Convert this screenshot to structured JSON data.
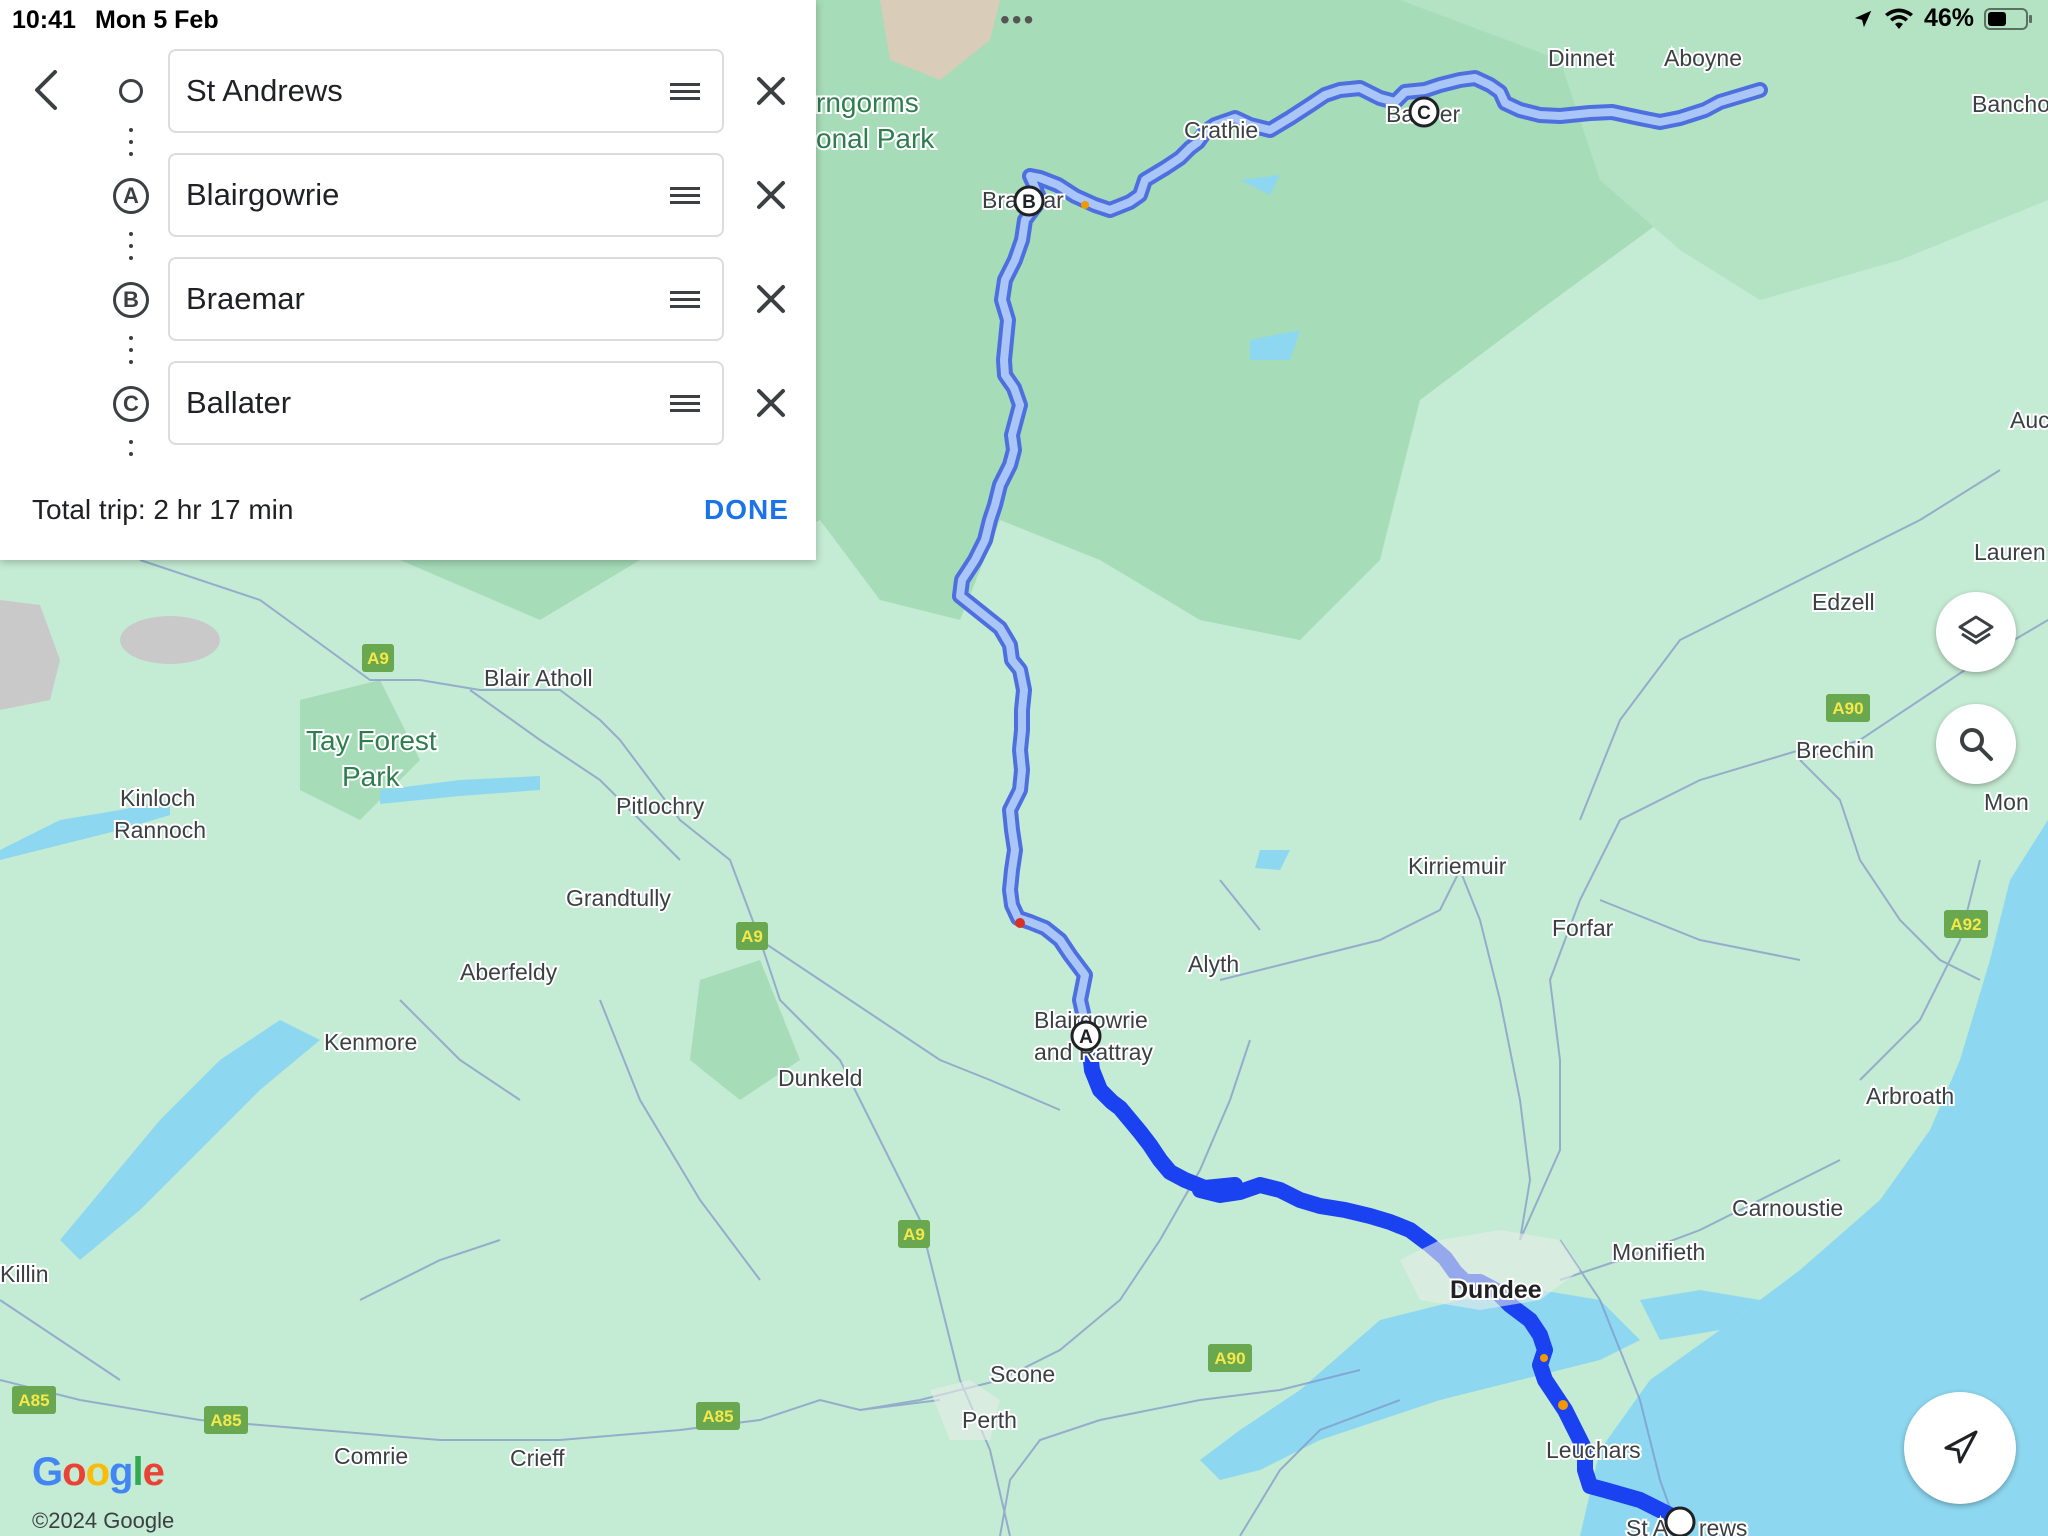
{
  "status_bar": {
    "time": "10:41",
    "date": "Mon 5 Feb",
    "battery": "46%"
  },
  "directions_panel": {
    "stops": [
      {
        "marker": "",
        "name": "St Andrews"
      },
      {
        "marker": "A",
        "name": "Blairgowrie"
      },
      {
        "marker": "B",
        "name": "Braemar"
      },
      {
        "marker": "C",
        "name": "Ballater"
      }
    ],
    "total_trip": "Total trip: 2 hr 17 min",
    "done_label": "DONE"
  },
  "map": {
    "places": [
      {
        "id": "dinnet",
        "name": "Dinnet"
      },
      {
        "id": "aboyne",
        "name": "Aboyne"
      },
      {
        "id": "banchory",
        "name": "Bancho"
      },
      {
        "id": "cairngorms1",
        "name": "rngorms"
      },
      {
        "id": "cairngorms2",
        "name": "onal Park"
      },
      {
        "id": "crathie",
        "name": "Crathie"
      },
      {
        "id": "ballater",
        "name": "Ba    er"
      },
      {
        "id": "braemar",
        "name": "Bra    ar"
      },
      {
        "id": "auchen",
        "name": "Auc"
      },
      {
        "id": "laurence",
        "name": "Lauren"
      },
      {
        "id": "edzell",
        "name": "Edzell"
      },
      {
        "id": "blair-atholl",
        "name": "Blair Atholl"
      },
      {
        "id": "tay-forest1",
        "name": "Tay Forest"
      },
      {
        "id": "tay-forest2",
        "name": "Park"
      },
      {
        "id": "kinloch1",
        "name": "Kinloch"
      },
      {
        "id": "kinloch2",
        "name": "Rannoch"
      },
      {
        "id": "pitlochry",
        "name": "Pitlochry"
      },
      {
        "id": "brechin",
        "name": "Brechin"
      },
      {
        "id": "montrose",
        "name": "Mon"
      },
      {
        "id": "kirriemuir",
        "name": "Kirriemuir"
      },
      {
        "id": "grandtully",
        "name": "Grandtully"
      },
      {
        "id": "forfar",
        "name": "Forfar"
      },
      {
        "id": "alyth",
        "name": "Alyth"
      },
      {
        "id": "aberfeldy",
        "name": "Aberfeldy"
      },
      {
        "id": "blairgowrie1",
        "name": "Blairgowrie"
      },
      {
        "id": "blairgowrie2",
        "name": "and Rattray"
      },
      {
        "id": "kenmore",
        "name": "Kenmore"
      },
      {
        "id": "dunkeld",
        "name": "Dunkeld"
      },
      {
        "id": "arbroath",
        "name": "Arbroath"
      },
      {
        "id": "carnoustie",
        "name": "Carnoustie"
      },
      {
        "id": "killin",
        "name": "Killin"
      },
      {
        "id": "monifieth",
        "name": "Monifieth"
      },
      {
        "id": "dundee",
        "name": "Dundee"
      },
      {
        "id": "scone",
        "name": "Scone"
      },
      {
        "id": "perth",
        "name": "Perth"
      },
      {
        "id": "leuchars",
        "name": "Leuchars"
      },
      {
        "id": "comrie",
        "name": "Comrie"
      },
      {
        "id": "crieff",
        "name": "Crieff"
      },
      {
        "id": "st-andrews",
        "name": "St A     rews"
      }
    ],
    "road_badges": [
      {
        "id": "a9-1",
        "label": "A9"
      },
      {
        "id": "a9-2",
        "label": "A9"
      },
      {
        "id": "a9-3",
        "label": "A9"
      },
      {
        "id": "a90-1",
        "label": "A90"
      },
      {
        "id": "a90-2",
        "label": "A90"
      },
      {
        "id": "a92",
        "label": "A92"
      },
      {
        "id": "a85-1",
        "label": "A85"
      },
      {
        "id": "a85-2",
        "label": "A85"
      },
      {
        "id": "a85-3",
        "label": "A85"
      }
    ],
    "route_markers": [
      {
        "id": "marker-a",
        "label": "A"
      },
      {
        "id": "marker-b",
        "label": "B"
      },
      {
        "id": "marker-c",
        "label": "C"
      }
    ]
  },
  "attribution": {
    "logo": "Google",
    "copyright": "©2024 Google"
  },
  "colors": {
    "route_primary": "#1a42f0",
    "route_alt": "#8fb6f5",
    "water": "#8dd8f0",
    "land": "#bfe8cf",
    "highlands": "#9fdbb2",
    "link": "#1a73e8",
    "badge": "#6aa84f"
  },
  "icons": {
    "back": "chevron-left-icon",
    "remove": "close-icon",
    "drag": "drag-handle-icon",
    "layers": "layers-icon",
    "search": "search-icon",
    "navigate": "navigation-arrow-icon"
  }
}
